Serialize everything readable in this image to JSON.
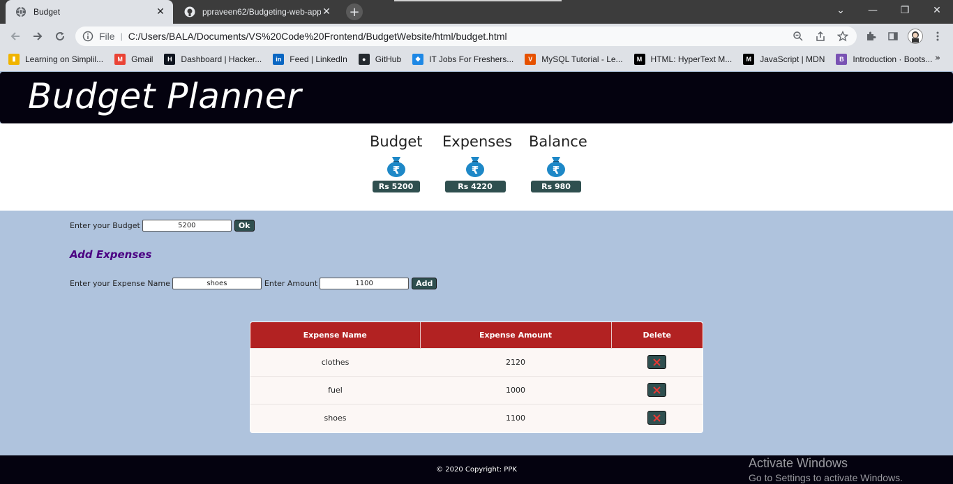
{
  "browser": {
    "tabs": [
      {
        "title": "Budget",
        "active": true
      },
      {
        "title": "ppraveen62/Budgeting-web-app",
        "active": false
      }
    ],
    "address": {
      "scheme": "File",
      "url": "C:/Users/BALA/Documents/VS%20Code%20Frontend/BudgetWebsite/html/budget.html"
    },
    "bookmarks": [
      {
        "label": "Learning on Simplil...",
        "icon": "simplilearn-icon",
        "color": "#f0b400"
      },
      {
        "label": "Gmail",
        "icon": "gmail-icon",
        "color": "#ea4335"
      },
      {
        "label": "Dashboard | Hacker...",
        "icon": "hackerrank-icon",
        "color": "#0e141e"
      },
      {
        "label": "Feed | LinkedIn",
        "icon": "linkedin-icon",
        "color": "#0a66c2"
      },
      {
        "label": "GitHub",
        "icon": "github-icon",
        "color": "#24292e"
      },
      {
        "label": "IT Jobs For Freshers...",
        "icon": "jobs-icon",
        "color": "#1e88e5"
      },
      {
        "label": "MySQL Tutorial - Le...",
        "icon": "mysql-icon",
        "color": "#e65100"
      },
      {
        "label": "HTML: HyperText M...",
        "icon": "mdn-icon",
        "color": "#000000"
      },
      {
        "label": "JavaScript | MDN",
        "icon": "mdn-icon",
        "color": "#000000"
      },
      {
        "label": "Introduction · Boots...",
        "icon": "bootstrap-icon",
        "color": "#7952b3"
      }
    ],
    "bookmarks_more": "»"
  },
  "app": {
    "title": "Budget Planner",
    "summary": [
      {
        "label": "Budget",
        "amount": "Rs 5200"
      },
      {
        "label": "Expenses",
        "amount": "Rs 4220"
      },
      {
        "label": "Balance",
        "amount": "Rs 980"
      }
    ],
    "budget_form": {
      "label": "Enter your Budget",
      "value": "5200",
      "button": "Ok"
    },
    "add_expenses_title": "Add Expenses",
    "expense_form": {
      "name_label": "Enter your Expense Name",
      "name_value": "shoes",
      "amount_label": "Enter Amount",
      "amount_value": "1100",
      "button": "Add"
    },
    "table": {
      "headers": [
        "Expense Name",
        "Expense Amount",
        "Delete"
      ],
      "rows": [
        {
          "name": "clothes",
          "amount": "2120"
        },
        {
          "name": "fuel",
          "amount": "1000"
        },
        {
          "name": "shoes",
          "amount": "1100"
        }
      ]
    },
    "footer": "© 2020 Copyright: PPK"
  },
  "watermark": {
    "line1": "Activate Windows",
    "line2": "Go to Settings to activate Windows."
  },
  "colors": {
    "header_bg": "#04020f",
    "page_bg": "#afc3dd",
    "button_bg": "#2f4f4f",
    "table_header": "#b22222",
    "section_title": "#4b0082",
    "bag_icon": "#1e88c7"
  }
}
